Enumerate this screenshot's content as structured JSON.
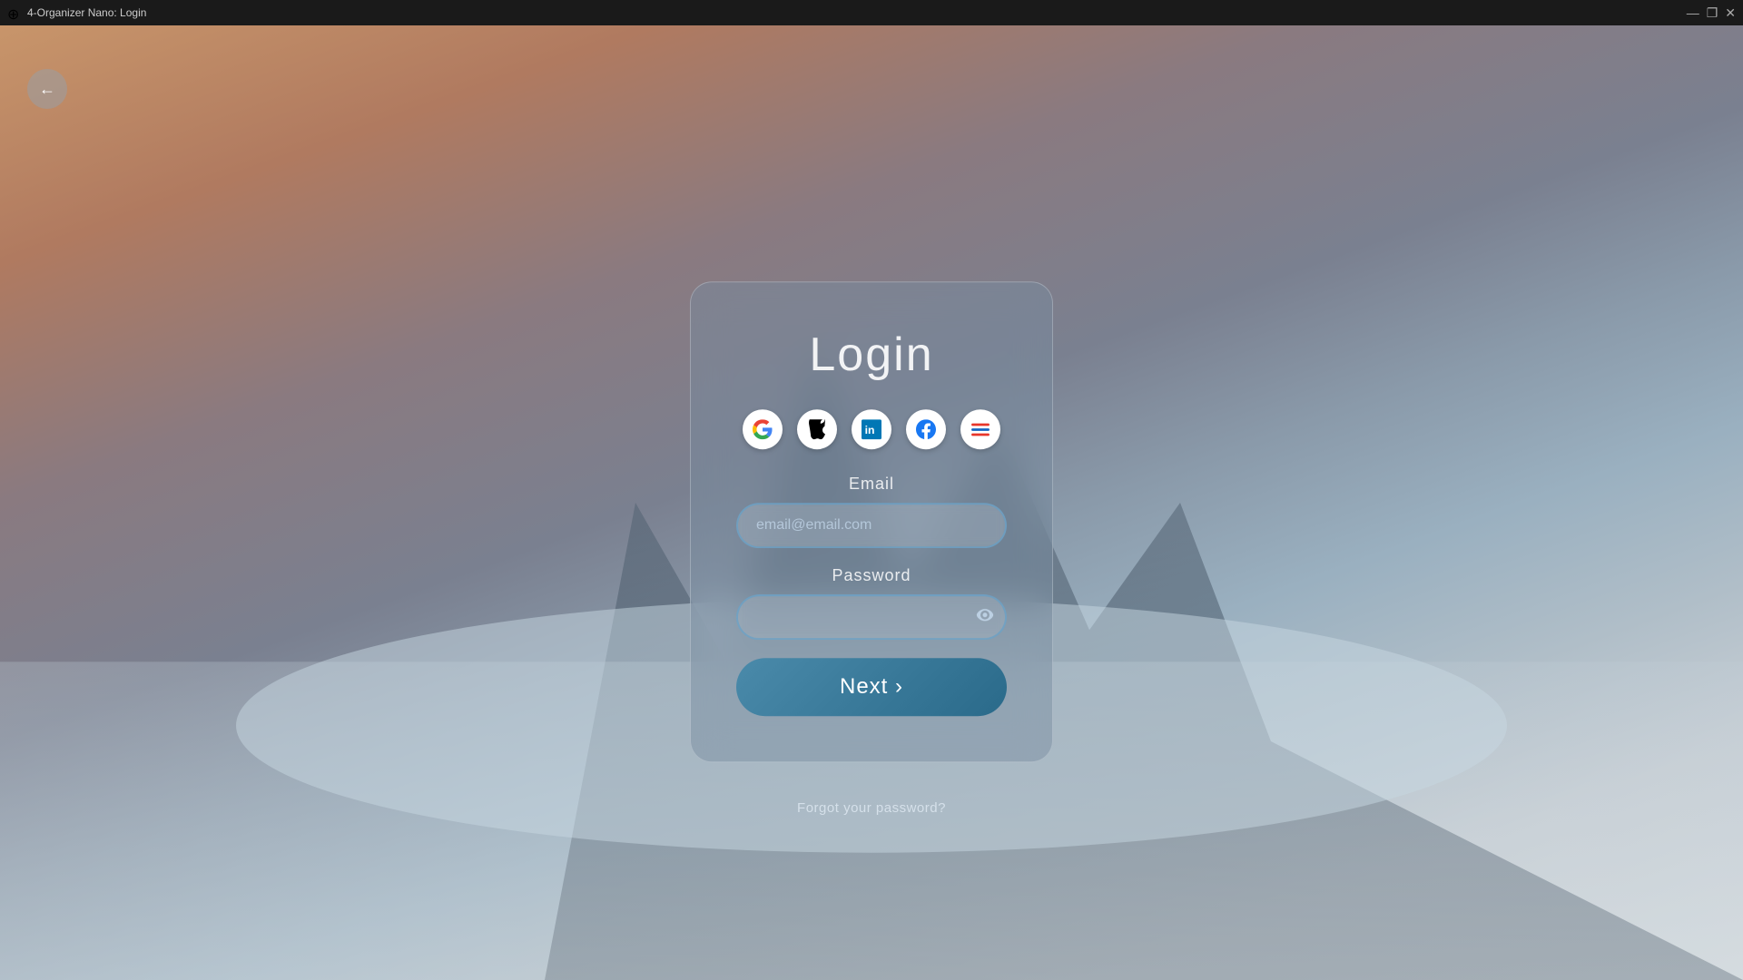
{
  "titlebar": {
    "title": "4-Organizer Nano: Login",
    "icon": "⊕",
    "controls": {
      "minimize": "—",
      "restore": "❐",
      "close": "✕"
    }
  },
  "back_button": {
    "label": "←"
  },
  "login_card": {
    "title": "Login",
    "social_icons": [
      {
        "name": "google",
        "label": "G",
        "aria": "Login with Google"
      },
      {
        "name": "apple",
        "label": "",
        "aria": "Login with Apple"
      },
      {
        "name": "linkedin",
        "label": "in",
        "aria": "Login with LinkedIn"
      },
      {
        "name": "facebook",
        "label": "f",
        "aria": "Login with Facebook"
      },
      {
        "name": "app",
        "label": "≡",
        "aria": "Login with App"
      }
    ],
    "email_label": "Email",
    "email_placeholder": "email@email.com",
    "password_label": "Password",
    "password_placeholder": "",
    "next_button": "Next ›",
    "forgot_password": "Forgot your password?"
  }
}
